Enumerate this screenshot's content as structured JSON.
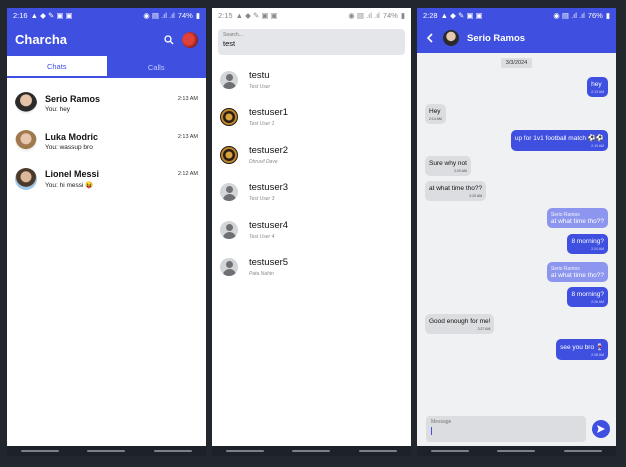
{
  "colors": {
    "accent": "#3f4fe0",
    "accent_light": "#8d96ee",
    "incoming_bubble": "#dcdde0",
    "background": "#22262d"
  },
  "chat_list_screen": {
    "status_bar": {
      "time": "2:16",
      "battery": "74%"
    },
    "app_title": "Charcha",
    "tabs": [
      "Chats",
      "Calls"
    ],
    "active_tab": "Chats",
    "chats": [
      {
        "name": "Serio Ramos",
        "time": "2:13 AM",
        "last_message": "You: hey"
      },
      {
        "name": "Luka Modric",
        "time": "2:13 AM",
        "last_message": "You: wassup bro"
      },
      {
        "name": "Lionel Messi",
        "time": "2:12 AM",
        "last_message": "You: hi messi 😝"
      }
    ]
  },
  "search_screen": {
    "status_bar": {
      "time": "2:15",
      "battery": "74%"
    },
    "search": {
      "placeholder": "Search...",
      "value": "test"
    },
    "results": [
      {
        "username": "testu",
        "display_name": "Test User",
        "avatar": "person-icon"
      },
      {
        "username": "testuser1",
        "display_name": "Test User 1",
        "avatar": "pattern"
      },
      {
        "username": "testuser2",
        "display_name": "Dhruvil Dave",
        "avatar": "pattern"
      },
      {
        "username": "testuser3",
        "display_name": "Test User 3",
        "avatar": "person-icon"
      },
      {
        "username": "testuser4",
        "display_name": "Test User 4",
        "avatar": "person-icon"
      },
      {
        "username": "testuser5",
        "display_name": "Pata Nahin",
        "avatar": "person-icon"
      }
    ]
  },
  "conversation_screen": {
    "status_bar": {
      "time": "2:28",
      "battery": "76%"
    },
    "contact_name": "Serio Ramos",
    "date_label": "3/3/2024",
    "messages": [
      {
        "direction": "out",
        "text": "hey",
        "time": "2:13 AM"
      },
      {
        "direction": "in",
        "text": "Hey",
        "time": "2:14 AM"
      },
      {
        "direction": "out",
        "text": "up for 1v1 football match ⚽⚽",
        "time": "2:19 AM"
      },
      {
        "direction": "in",
        "text": "Sure why not",
        "time": "2:20 AM"
      },
      {
        "direction": "in",
        "text": "at what time tho??",
        "time": "2:20 AM"
      },
      {
        "direction": "out",
        "quote_name": "Serio Ramos",
        "quote_text": "at what time tho??",
        "text": "8 morning?",
        "time": "2:24 AM"
      },
      {
        "direction": "out",
        "quote_name": "Serio Ramos",
        "quote_text": "at what time tho??",
        "text": "8 morning?",
        "time": "2:26 AM"
      },
      {
        "direction": "in",
        "text": "Good enough for me!",
        "time": "2:27 AM"
      },
      {
        "direction": "out",
        "text": "see you bro 🍷",
        "time": "2:28 AM"
      }
    ],
    "message_input": {
      "placeholder": "Message"
    }
  }
}
